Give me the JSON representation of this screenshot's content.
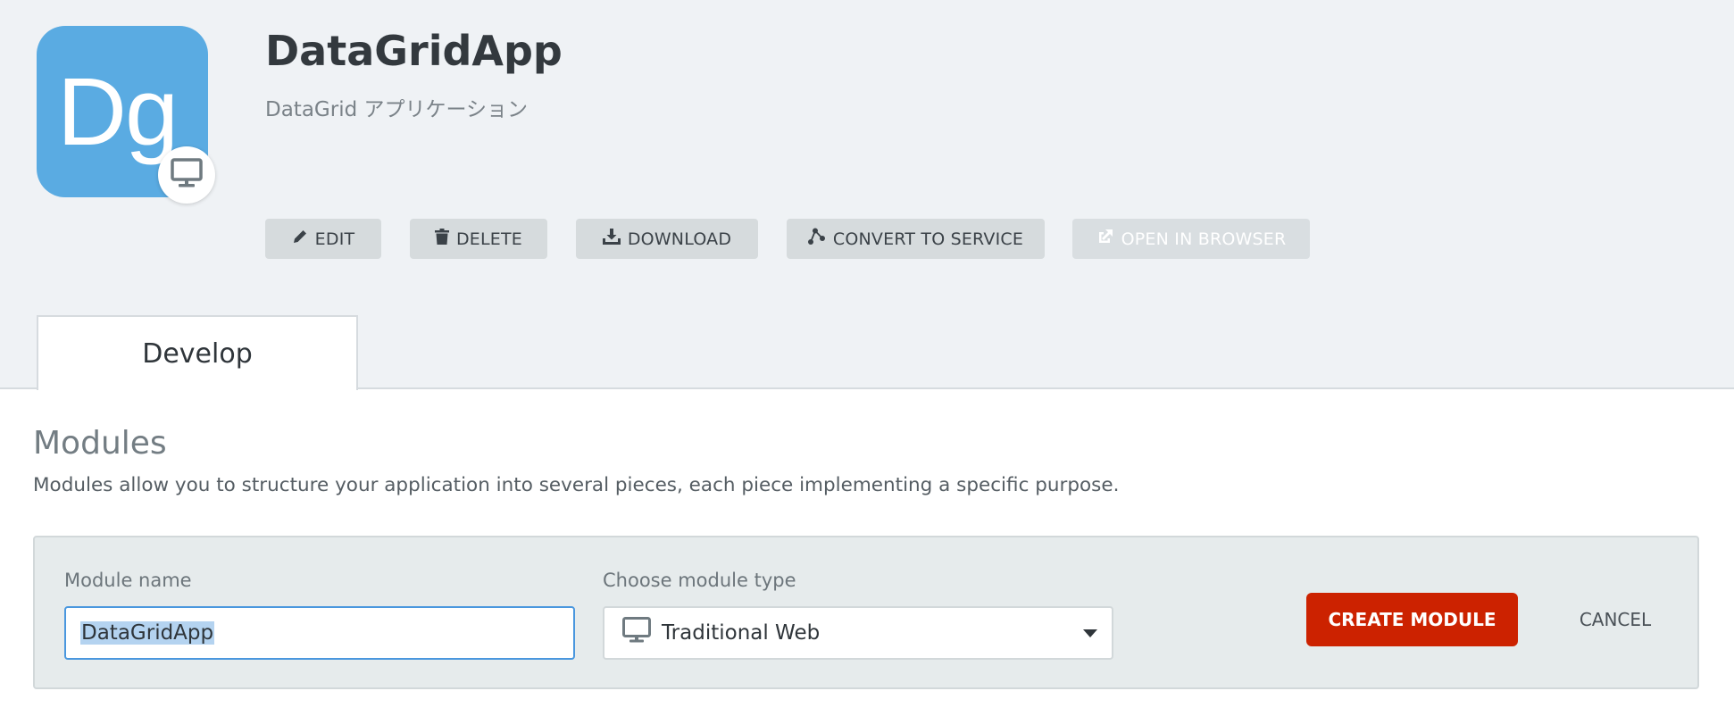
{
  "app": {
    "icon_text": "Dg",
    "icon_color": "#5aabe2",
    "platform_icon": "monitor-icon",
    "title": "DataGridApp",
    "subtitle": "DataGrid アプリケーション"
  },
  "actions": {
    "edit": {
      "label": "EDIT",
      "icon": "pencil-icon"
    },
    "delete": {
      "label": "DELETE",
      "icon": "trash-icon"
    },
    "download": {
      "label": "DOWNLOAD",
      "icon": "download-icon"
    },
    "convert": {
      "label": "CONVERT TO SERVICE",
      "icon": "share-nodes-icon"
    },
    "open_browser": {
      "label": "OPEN IN BROWSER",
      "icon": "external-link-icon",
      "disabled": true
    }
  },
  "tabs": [
    {
      "label": "Develop",
      "active": true
    }
  ],
  "modules": {
    "title": "Modules",
    "description": "Modules allow you to structure your application into several pieces, each piece implementing a specific purpose."
  },
  "form": {
    "name_label": "Module name",
    "name_value": "DataGridApp",
    "type_label": "Choose module type",
    "type_value": "Traditional Web",
    "type_icon": "monitor-icon",
    "create_label": "CREATE MODULE",
    "cancel_label": "CANCEL",
    "create_color": "#cc2200"
  }
}
